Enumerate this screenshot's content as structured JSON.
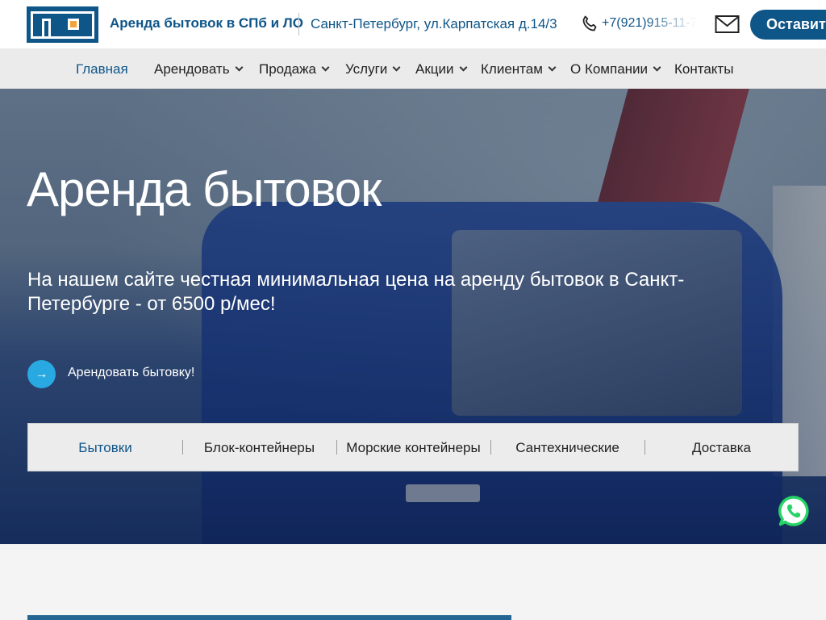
{
  "header": {
    "site_name": "Аренда бытовок в СПб и ЛО",
    "address": "Санкт-Петербург, ул.Карпатская д.14/3",
    "phone": "+7(921)915-11-7",
    "cta_label": "Оставит",
    "icons": {
      "logo": "cabin-logo-icon",
      "phone": "phone-icon",
      "mail": "mail-icon"
    },
    "colors": {
      "brand": "#0e5588",
      "accent": "#f2a33a"
    }
  },
  "nav": {
    "items": [
      {
        "label": "Главная",
        "active": true,
        "dropdown": false
      },
      {
        "label": "Арендовать",
        "dropdown": true
      },
      {
        "label": "Продажа",
        "dropdown": true
      },
      {
        "label": "Услуги",
        "dropdown": true
      },
      {
        "label": "Акции",
        "dropdown": true
      },
      {
        "label": "Клиентам",
        "dropdown": true
      },
      {
        "label": "О Компании",
        "dropdown": true
      },
      {
        "label": "Контакты",
        "dropdown": false
      }
    ]
  },
  "hero": {
    "title": "Аренда бытовок",
    "subtitle": "На нашем сайте честная минимальная цена на аренду бытовок в Санкт-Петербурге - от 6500 р/мес!",
    "button_label": "Арендовать бытовку!",
    "button_icon": "arrow-right-icon",
    "button_color": "#29a9e1",
    "categories": [
      {
        "label": "Бытовки",
        "active": true
      },
      {
        "label": "Блок-контейнеры"
      },
      {
        "label": "Морские контейнеры"
      },
      {
        "label": "Сантехнические"
      },
      {
        "label": "Доставка"
      }
    ]
  },
  "widgets": {
    "whatsapp_icon": "whatsapp-icon",
    "whatsapp_color": "#25d366"
  }
}
